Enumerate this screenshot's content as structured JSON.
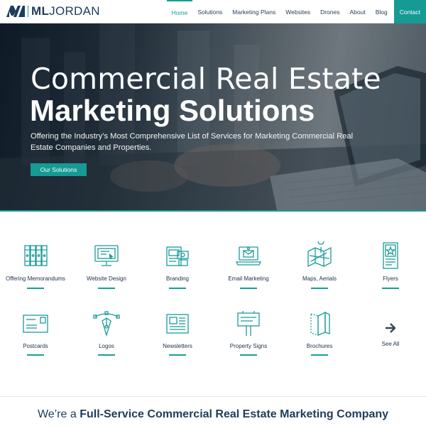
{
  "nav": {
    "logo_bold": "ML",
    "logo_light": "JORDAN",
    "items": [
      {
        "label": "Home",
        "active": true
      },
      {
        "label": "Solutions"
      },
      {
        "label": "Marketing Plans"
      },
      {
        "label": "Websites"
      },
      {
        "label": "Drones"
      },
      {
        "label": "About"
      },
      {
        "label": "Blog"
      }
    ],
    "contact": "Contact"
  },
  "hero": {
    "title_light": "Commercial Real Estate",
    "title_bold": "Marketing Solutions",
    "subtitle": "Offering the Industry’s Most Comprehensive List of Services for Marketing Commercial Real Estate Companies and Properties.",
    "button": "Our Solutions"
  },
  "services": [
    {
      "label": "Offering Memorandums",
      "icon": "binders-icon"
    },
    {
      "label": "Website Design",
      "icon": "monitor-icon"
    },
    {
      "label": "Branding",
      "icon": "branding-icon"
    },
    {
      "label": "Email Marketing",
      "icon": "email-laptop-icon"
    },
    {
      "label": "Maps, Aerials",
      "icon": "map-icon"
    },
    {
      "label": "Flyers",
      "icon": "flyer-icon"
    },
    {
      "label": "Postcards",
      "icon": "postcard-icon"
    },
    {
      "label": "Logos",
      "icon": "pen-tool-icon"
    },
    {
      "label": "Newsletters",
      "icon": "newspaper-icon"
    },
    {
      "label": "Property Signs",
      "icon": "sign-icon"
    },
    {
      "label": "Brochures",
      "icon": "brochure-icon"
    }
  ],
  "see_all": "See All",
  "tagline": {
    "prefix": "We’re a",
    "bold": "Full-Service Commercial Real Estate Marketing Company"
  },
  "colors": {
    "accent": "#159a94",
    "navy": "#1e3c5c"
  }
}
